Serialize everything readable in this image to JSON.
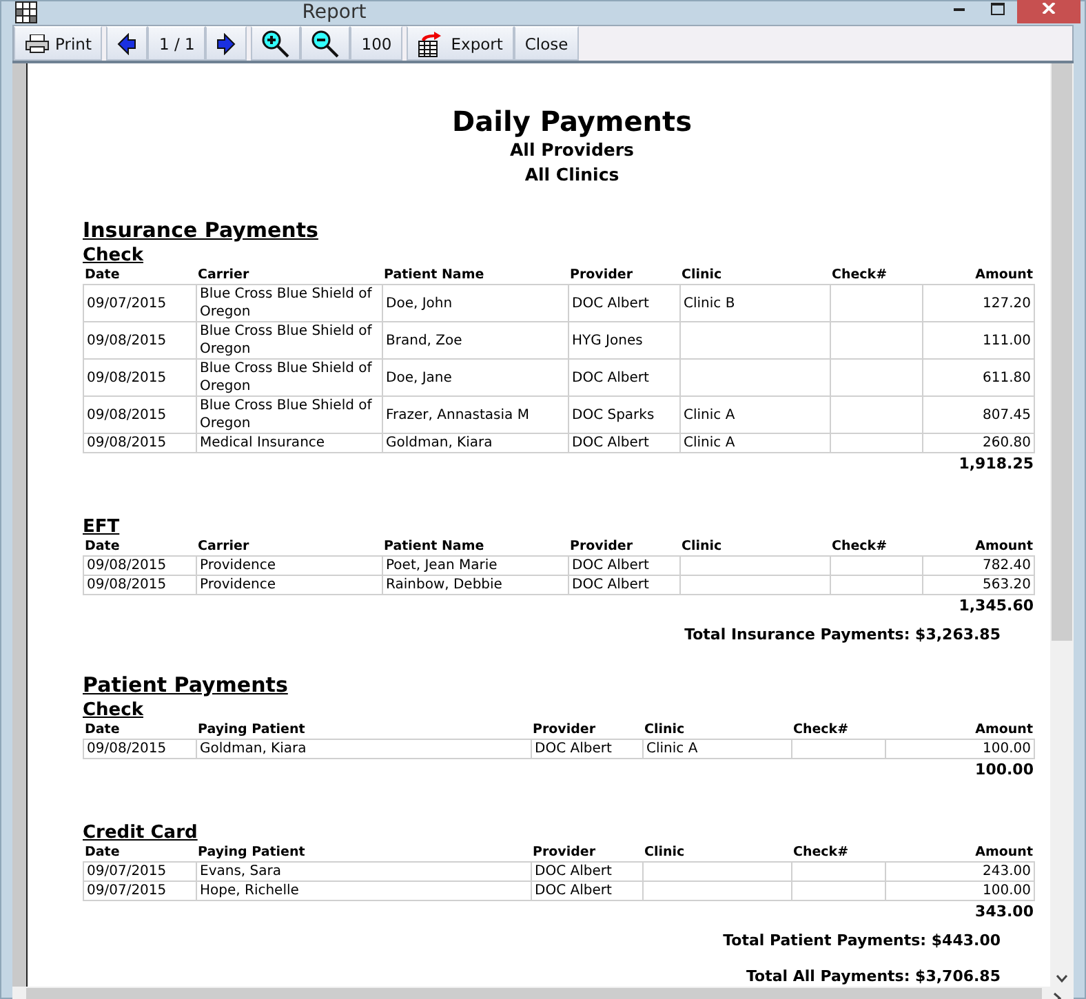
{
  "window": {
    "title": "Report"
  },
  "toolbar": [
    {
      "kind": "print",
      "label": "Print"
    },
    {
      "kind": "prev"
    },
    {
      "kind": "text",
      "label": "1 / 1"
    },
    {
      "kind": "next"
    },
    {
      "kind": "zoomin"
    },
    {
      "kind": "zoomout"
    },
    {
      "kind": "text",
      "label": "100"
    },
    {
      "kind": "export",
      "label": "Export"
    },
    {
      "kind": "text",
      "label": "Close"
    }
  ],
  "report": {
    "title": "Daily Payments",
    "subtitles": [
      "All Providers",
      "All Clinics"
    ],
    "sections": [
      {
        "heading": "Insurance Payments",
        "kind": "insurance",
        "groups": [
          {
            "heading": "Check",
            "columns": [
              "Date",
              "Carrier",
              "Patient Name",
              "Provider",
              "Clinic",
              "Check#",
              "Amount"
            ],
            "rows": [
              [
                "09/07/2015",
                "Blue Cross Blue Shield of Oregon",
                "Doe, John",
                "DOC Albert",
                "Clinic B",
                "",
                "127.20"
              ],
              [
                "09/08/2015",
                "Blue Cross Blue Shield of Oregon",
                "Brand, Zoe",
                "HYG Jones",
                "",
                "",
                "111.00"
              ],
              [
                "09/08/2015",
                "Blue Cross Blue Shield of Oregon",
                "Doe, Jane",
                "DOC Albert",
                "",
                "",
                "611.80"
              ],
              [
                "09/08/2015",
                "Blue Cross Blue Shield of Oregon",
                "Frazer, Annastasia M",
                "DOC Sparks",
                "Clinic A",
                "",
                "807.45"
              ],
              [
                "09/08/2015",
                "Medical Insurance",
                "Goldman, Kiara",
                "DOC Albert",
                "Clinic A",
                "",
                "260.80"
              ]
            ],
            "subtotal": "1,918.25"
          },
          {
            "heading": "EFT",
            "columns": [
              "Date",
              "Carrier",
              "Patient Name",
              "Provider",
              "Clinic",
              "Check#",
              "Amount"
            ],
            "rows": [
              [
                "09/08/2015",
                "Providence",
                "Poet, Jean Marie",
                "DOC Albert",
                "",
                "",
                "782.40"
              ],
              [
                "09/08/2015",
                "Providence",
                "Rainbow, Debbie",
                "DOC Albert",
                "",
                "",
                "563.20"
              ]
            ],
            "subtotal": "1,345.60"
          }
        ],
        "total": "Total Insurance Payments: $3,263.85"
      },
      {
        "heading": "Patient Payments",
        "kind": "patient",
        "groups": [
          {
            "heading": "Check",
            "columns": [
              "Date",
              "Paying Patient",
              "Provider",
              "Clinic",
              "Check#",
              "Amount"
            ],
            "rows": [
              [
                "09/08/2015",
                "Goldman, Kiara",
                "DOC Albert",
                "Clinic A",
                "",
                "100.00"
              ]
            ],
            "subtotal": "100.00"
          },
          {
            "heading": "Credit Card",
            "columns": [
              "Date",
              "Paying Patient",
              "Provider",
              "Clinic",
              "Check#",
              "Amount"
            ],
            "rows": [
              [
                "09/07/2015",
                "Evans, Sara",
                "DOC Albert",
                "",
                "",
                "243.00"
              ],
              [
                "09/07/2015",
                "Hope, Richelle",
                "DOC Albert",
                "",
                "",
                "100.00"
              ]
            ],
            "subtotal": "343.00"
          }
        ],
        "total": "Total Patient Payments: $443.00"
      }
    ],
    "grand_total": "Total All Payments: $3,706.85"
  }
}
